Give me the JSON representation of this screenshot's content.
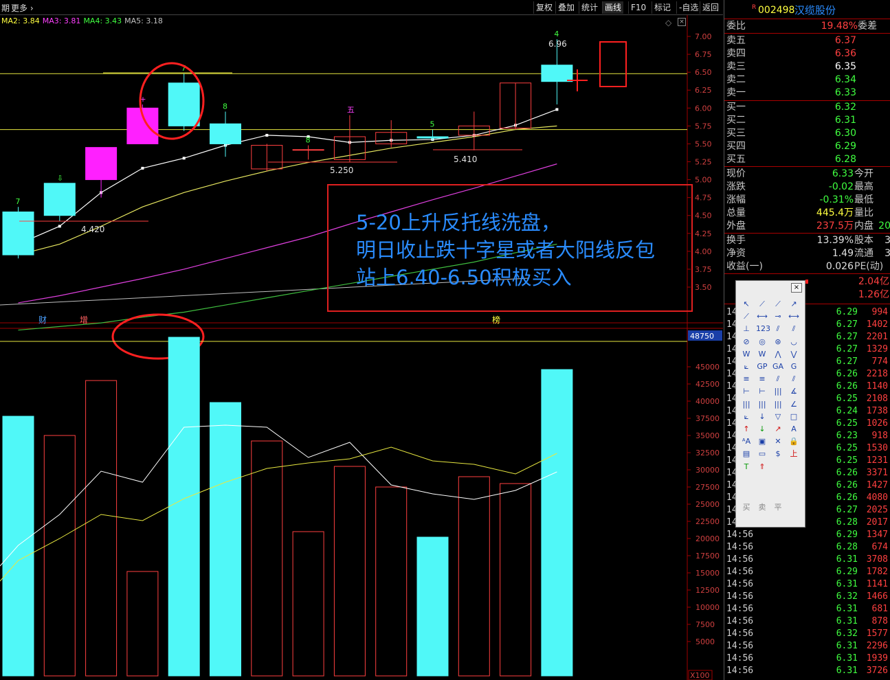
{
  "topbar": {
    "left_label": "期",
    "more_label": "更多",
    "buttons": [
      "复权",
      "叠加",
      "统计",
      "画线",
      "F10",
      "标记",
      "-自选",
      "返回"
    ],
    "active_button": "画线"
  },
  "ma_legend": [
    {
      "label": "MA2: 3.84",
      "color": "#ffff40"
    },
    {
      "label": "MA3: 3.81",
      "color": "#ff40ff"
    },
    {
      "label": "MA4: 3.43",
      "color": "#40ff40"
    },
    {
      "label": "MA5: 3.18",
      "color": "#c0c0c0"
    }
  ],
  "chart_data": [
    {
      "type": "candlestick",
      "title": "",
      "ylim": [
        3.3,
        7.2
      ],
      "y_ticks": [
        "7.00",
        "6.75",
        "6.50",
        "6.25",
        "6.00",
        "5.75",
        "5.50",
        "5.25",
        "5.00",
        "4.75",
        "4.50",
        "4.25",
        "4.00",
        "3.75",
        "3.50"
      ],
      "candles": [
        {
          "open": 3.95,
          "close": 4.55,
          "high": 4.62,
          "low": 3.9,
          "dir": "down",
          "label": "7"
        },
        {
          "open": 4.5,
          "close": 4.95,
          "high": 4.95,
          "low": 4.42,
          "dir": "down",
          "label": "⇩"
        },
        {
          "open": 5.0,
          "close": 5.45,
          "high": 5.45,
          "low": 4.75,
          "dir": "up",
          "label": ""
        },
        {
          "open": 5.5,
          "close": 6.0,
          "high": 6.05,
          "low": 5.5,
          "dir": "up",
          "label": "+"
        },
        {
          "open": 5.75,
          "close": 6.35,
          "high": 6.48,
          "low": 5.68,
          "dir": "down",
          "label": "7"
        },
        {
          "open": 5.5,
          "close": 5.78,
          "high": 5.95,
          "low": 5.32,
          "dir": "down",
          "label": "8"
        },
        {
          "open": 5.15,
          "close": 5.48,
          "high": 5.5,
          "low": 5.12,
          "dir": "up",
          "label": ""
        },
        {
          "open": 5.42,
          "close": 5.42,
          "high": 5.48,
          "low": 5.28,
          "dir": "up",
          "label": "8"
        },
        {
          "open": 5.28,
          "close": 5.6,
          "high": 5.9,
          "low": 5.25,
          "dir": "up",
          "label": "五"
        },
        {
          "open": 5.5,
          "close": 5.66,
          "high": 5.83,
          "low": 5.45,
          "dir": "up",
          "label": ""
        },
        {
          "open": 5.58,
          "close": 5.6,
          "high": 5.7,
          "low": 5.55,
          "dir": "down",
          "label": "5"
        },
        {
          "open": 5.62,
          "close": 5.75,
          "high": 5.95,
          "low": 5.41,
          "dir": "up",
          "label": ""
        },
        {
          "open": 5.72,
          "close": 6.35,
          "high": 6.35,
          "low": 5.7,
          "dir": "up",
          "label": ""
        },
        {
          "open": 6.37,
          "close": 6.6,
          "high": 6.96,
          "low": 6.05,
          "dir": "down",
          "label": "4"
        }
      ],
      "price_annotations": [
        "4.420",
        "5.250",
        "5.410",
        "6.96"
      ],
      "ma_lines": {
        "white": [
          4.1,
          4.35,
          4.82,
          5.16,
          5.3,
          5.48,
          5.62,
          5.6,
          5.52,
          5.55,
          5.56,
          5.62,
          5.76,
          5.98
        ],
        "yellow": [
          3.95,
          4.1,
          4.35,
          4.62,
          4.82,
          4.98,
          5.12,
          5.24,
          5.34,
          5.44,
          5.52,
          5.6,
          5.7,
          5.75
        ],
        "magenta": [
          3.28,
          3.38,
          3.5,
          3.62,
          3.75,
          3.9,
          4.05,
          4.2,
          4.38,
          4.55,
          4.72,
          4.88,
          5.05,
          5.22
        ],
        "green": [
          2.9,
          2.95,
          3.0,
          3.08,
          3.15,
          3.25,
          3.35,
          3.45,
          3.55,
          3.65,
          3.75,
          3.85,
          3.98,
          4.1
        ]
      },
      "hlines": [
        6.48,
        5.7
      ]
    },
    {
      "type": "bar",
      "title": "",
      "ylim": [
        0,
        50000
      ],
      "y_ticks": [
        "45000",
        "42500",
        "40000",
        "37500",
        "35000",
        "32500",
        "30000",
        "27500",
        "25000",
        "22500",
        "20000",
        "17500",
        "15000",
        "12500",
        "10000",
        "7500",
        "5000"
      ],
      "marker_value": "48750",
      "unit_label": "X100",
      "values": [
        37800,
        35000,
        43000,
        15200,
        49300,
        39800,
        34200,
        21000,
        30500,
        27500,
        20200,
        29000,
        28000,
        44600
      ],
      "dir": [
        "down",
        "up",
        "up",
        "up",
        "down",
        "down",
        "up",
        "up",
        "up",
        "up",
        "down",
        "up",
        "up",
        "down"
      ],
      "ma_white": [
        19000,
        23500,
        29800,
        28200,
        36200,
        36500,
        36200,
        31800,
        34000,
        27800,
        26500,
        25700,
        27000,
        29700
      ],
      "ma_yellow": [
        16800,
        20000,
        23500,
        22600,
        25800,
        28200,
        30200,
        31000,
        31600,
        33300,
        31300,
        30800,
        29400,
        32400
      ],
      "event_labels": [
        {
          "text": "财",
          "color": "#4aa0ff"
        },
        {
          "text": "增",
          "color": "#ff6060"
        },
        {
          "text": "榜",
          "color": "#ffff40"
        }
      ]
    }
  ],
  "annotation": {
    "lines": [
      "5-20上升反托线洗盘，",
      "明日收止跌十字星或者大阳线反包",
      "站上6.40-6.50积极买入"
    ]
  },
  "stock": {
    "code": "002498",
    "name": "汉缆股份",
    "flag": "R"
  },
  "order_book": {
    "ratio_label": "委比",
    "ratio_value": "19.48%",
    "diff_label": "委差",
    "sells": [
      {
        "label": "卖五",
        "price": "6.37",
        "color": "#ff4040"
      },
      {
        "label": "卖四",
        "price": "6.36",
        "color": "#ff4040"
      },
      {
        "label": "卖三",
        "price": "6.35",
        "color": "#ffffff"
      },
      {
        "label": "卖二",
        "price": "6.34",
        "color": "#40ff40"
      },
      {
        "label": "卖一",
        "price": "6.33",
        "color": "#40ff40"
      }
    ],
    "buys": [
      {
        "label": "买一",
        "price": "6.32",
        "color": "#40ff40"
      },
      {
        "label": "买二",
        "price": "6.31",
        "color": "#40ff40"
      },
      {
        "label": "买三",
        "price": "6.30",
        "color": "#40ff40"
      },
      {
        "label": "买四",
        "price": "6.29",
        "color": "#40ff40"
      },
      {
        "label": "买五",
        "price": "6.28",
        "color": "#40ff40"
      }
    ]
  },
  "quote": [
    {
      "label": "现价",
      "value": "6.33",
      "color": "#40ff40",
      "label2": "今开"
    },
    {
      "label": "涨跌",
      "value": "-0.02",
      "color": "#40ff40",
      "label2": "最高"
    },
    {
      "label": "涨幅",
      "value": "-0.31%",
      "color": "#40ff40",
      "label2": "最低"
    },
    {
      "label": "总量",
      "value": "445.4万",
      "color": "#ffff40",
      "label2": "量比"
    },
    {
      "label": "外盘",
      "value": "237.5万",
      "color": "#ff4040",
      "label2": "内盘",
      "value2": "20",
      "color2": "#40ff40"
    }
  ],
  "fundamentals": [
    {
      "label": "换手",
      "value": "13.39%",
      "label2": "股本",
      "value2": "3"
    },
    {
      "label": "净资",
      "value": "1.49",
      "label2": "流通",
      "value2": "3"
    },
    {
      "label": "收益(一)",
      "value": "0.026",
      "label2": "PE(动)",
      "value2": ""
    }
  ],
  "capital_flow": [
    {
      "value": "2.04亿",
      "color": "#ff4040"
    },
    {
      "value": "1.26亿",
      "color": "#ff4040"
    }
  ],
  "ticks": [
    {
      "time": "14",
      "price": "6.29",
      "vol": "994"
    },
    {
      "time": "14",
      "price": "6.27",
      "vol": "1402"
    },
    {
      "time": "14",
      "price": "6.27",
      "vol": "2201"
    },
    {
      "time": "14",
      "price": "6.27",
      "vol": "1329"
    },
    {
      "time": "14",
      "price": "6.27",
      "vol": "774"
    },
    {
      "time": "14",
      "price": "6.26",
      "vol": "2218"
    },
    {
      "time": "14",
      "price": "6.26",
      "vol": "1140"
    },
    {
      "time": "14",
      "price": "6.25",
      "vol": "2108"
    },
    {
      "time": "14",
      "price": "6.24",
      "vol": "1738"
    },
    {
      "time": "14",
      "price": "6.25",
      "vol": "1026"
    },
    {
      "time": "14",
      "price": "6.23",
      "vol": "918"
    },
    {
      "time": "14",
      "price": "6.25",
      "vol": "1530"
    },
    {
      "time": "14",
      "price": "6.25",
      "vol": "1231"
    },
    {
      "time": "14",
      "price": "6.26",
      "vol": "3371"
    },
    {
      "time": "14",
      "price": "6.26",
      "vol": "1427"
    },
    {
      "time": "14",
      "price": "6.26",
      "vol": "4080"
    },
    {
      "time": "14",
      "price": "6.27",
      "vol": "2025"
    },
    {
      "time": "14",
      "price": "6.28",
      "vol": "2017"
    },
    {
      "time": "14:56",
      "price": "6.29",
      "vol": "1347"
    },
    {
      "time": "14:56",
      "price": "6.28",
      "vol": "674"
    },
    {
      "time": "14:56",
      "price": "6.31",
      "vol": "3708"
    },
    {
      "time": "14:56",
      "price": "6.29",
      "vol": "1782"
    },
    {
      "time": "14:56",
      "price": "6.31",
      "vol": "1141"
    },
    {
      "time": "14:56",
      "price": "6.32",
      "vol": "1466"
    },
    {
      "time": "14:56",
      "price": "6.31",
      "vol": "681"
    },
    {
      "time": "14:56",
      "price": "6.31",
      "vol": "878"
    },
    {
      "time": "14:56",
      "price": "6.32",
      "vol": "1577"
    },
    {
      "time": "14:56",
      "price": "6.31",
      "vol": "2296"
    },
    {
      "time": "14:56",
      "price": "6.31",
      "vol": "1939"
    },
    {
      "time": "14:56",
      "price": "6.31",
      "vol": "3726"
    }
  ],
  "toolbox": {
    "close_label": "×",
    "bottom_labels": [
      "买",
      "卖",
      "平"
    ],
    "icons": [
      "cursor-icon",
      "line-icon",
      "ray-icon",
      "arrow-line-icon",
      "segment-icon",
      "hline-icon",
      "hray-icon",
      "hline2-icon",
      "vline-icon",
      "fib-123-icon",
      "parallel-icon",
      "channel-icon",
      "circle-line-icon",
      "circle-icon",
      "cycle-icon",
      "arc-icon",
      "wave-icon",
      "wave2-icon",
      "zigzag-icon",
      "zigzag2-icon",
      "fan-icon",
      "gp-icon",
      "ga-icon",
      "g-icon",
      "levels-icon",
      "levels2-icon",
      "gann-icon",
      "gann2-icon",
      "bars-icon",
      "bars2-icon",
      "bars3-icon",
      "angle-icon",
      "lines-icon",
      "lines2-icon",
      "lines3-icon",
      "speed-icon",
      "fan2-icon",
      "down-arrow-icon",
      "triangle-icon",
      "rect-icon",
      "up-red-icon",
      "down-green-icon",
      "up-arrow-icon",
      "text-icon",
      "text2-icon",
      "box-icon",
      "cross-icon",
      "lock-icon",
      "note-icon",
      "ruler-icon",
      "money-icon",
      "buy-icon",
      "sell-icon",
      "flat-icon"
    ],
    "glyphs": [
      "↖",
      "⟋",
      "⟋",
      "↗",
      "⟋",
      "⟷",
      "⊸",
      "⟷",
      "⊥",
      "123",
      "⫽",
      "⫽",
      "⊘",
      "◎",
      "⊛",
      "◡",
      "W",
      "W",
      "⋀",
      "⋁",
      "⟀",
      "GP",
      "GA",
      "G",
      "≡",
      "≡",
      "⫽",
      "⫽",
      "⊢",
      "⊢",
      "|||",
      "∡",
      "|||",
      "|||",
      "|||",
      "∠",
      "⟀",
      "↓",
      "▽",
      "□",
      "↑",
      "↓",
      "↗",
      "A",
      "ᴬA",
      "▣",
      "✕",
      "🔒",
      "▤",
      "▭",
      "$",
      "上",
      "T",
      "⇑"
    ]
  }
}
